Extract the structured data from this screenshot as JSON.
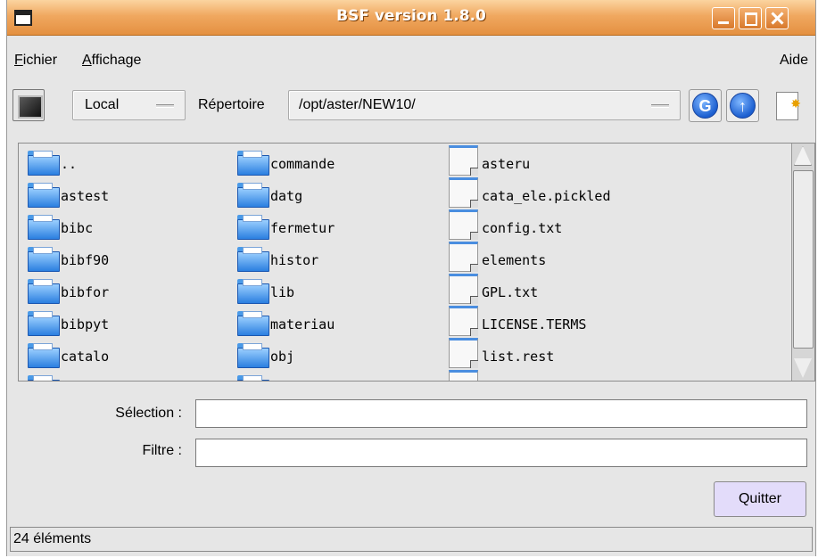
{
  "window": {
    "title": "BSF version 1.8.0"
  },
  "menu": {
    "fichier": "Fichier",
    "affichage": "Affichage",
    "aide": "Aide"
  },
  "toolbar": {
    "location": "Local",
    "directory_label": "Répertoire",
    "path": "/opt/aster/NEW10/",
    "icons": [
      "terminal-icon",
      "refresh-icon",
      "up-arrow-icon",
      "new-file-icon"
    ]
  },
  "files": {
    "column1": [
      {
        "name": "..",
        "type": "folder"
      },
      {
        "name": "astest",
        "type": "folder"
      },
      {
        "name": "bibc",
        "type": "folder"
      },
      {
        "name": "bibf90",
        "type": "folder"
      },
      {
        "name": "bibfor",
        "type": "folder"
      },
      {
        "name": "bibpyt",
        "type": "folder"
      },
      {
        "name": "catalo",
        "type": "folder"
      }
    ],
    "column2": [
      {
        "name": "commande",
        "type": "folder"
      },
      {
        "name": "datg",
        "type": "folder"
      },
      {
        "name": "fermetur",
        "type": "folder"
      },
      {
        "name": "histor",
        "type": "folder"
      },
      {
        "name": "lib",
        "type": "folder"
      },
      {
        "name": "materiau",
        "type": "folder"
      },
      {
        "name": "obj",
        "type": "folder"
      }
    ],
    "column3": [
      {
        "name": "asteru",
        "type": "file"
      },
      {
        "name": "cata_ele.pickled",
        "type": "file"
      },
      {
        "name": "config.txt",
        "type": "file"
      },
      {
        "name": "elements",
        "type": "file"
      },
      {
        "name": "GPL.txt",
        "type": "file"
      },
      {
        "name": "LICENSE.TERMS",
        "type": "file"
      },
      {
        "name": "list.rest",
        "type": "file"
      }
    ]
  },
  "form": {
    "selection_label": "Sélection :",
    "selection_value": "",
    "filter_label": "Filtre :",
    "filter_value": ""
  },
  "buttons": {
    "quit": "Quitter"
  },
  "status": {
    "text": "24 éléments"
  },
  "colors": {
    "titlebar": "#f0a860",
    "quit_button": "#e3dcfa",
    "folder": "#2b7fe0"
  }
}
